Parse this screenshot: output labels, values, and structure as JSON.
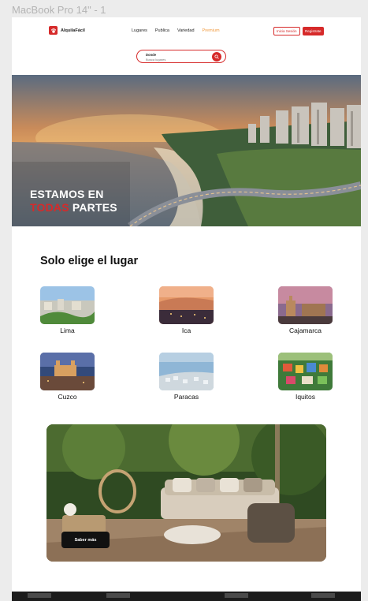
{
  "frame": {
    "label": "MacBook Pro 14\" - 1"
  },
  "header": {
    "brand": "AlquilaFácil",
    "logo_icon": "paw-icon",
    "menu": [
      "Lugares",
      "Publica",
      "Variedad",
      "Premium"
    ],
    "login_label": "Inicia Sesión",
    "register_label": "Registrate"
  },
  "search": {
    "label": "Donde",
    "placeholder": "Busca lugares",
    "icon": "search-icon"
  },
  "hero": {
    "line1": "ESTAMOS EN",
    "line2_highlight": "TODAS",
    "line2_rest": " PARTES"
  },
  "places": {
    "title": "Solo elige el lugar",
    "items": [
      {
        "name": "Lima"
      },
      {
        "name": "Ica"
      },
      {
        "name": "Cajamarca"
      },
      {
        "name": "Cuzco"
      },
      {
        "name": "Paracas"
      },
      {
        "name": "Iquitos"
      }
    ]
  },
  "promo": {
    "button_label": "Saber más"
  },
  "colors": {
    "brand_red": "#d62a2a",
    "premium_orange": "#f19a3e"
  }
}
